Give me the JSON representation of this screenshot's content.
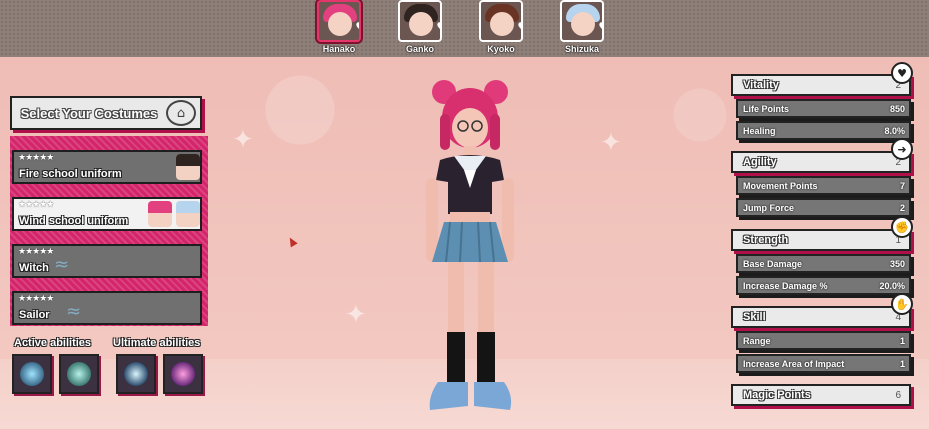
{
  "characters": [
    {
      "name": "Hanako",
      "hair": "#e2407e",
      "active": true
    },
    {
      "name": "Ganko",
      "hair": "#2f2420",
      "active": false
    },
    {
      "name": "Kyoko",
      "hair": "#6a3424",
      "active": false
    },
    {
      "name": "Shizuka",
      "hair": "#b7d4ef",
      "active": false
    }
  ],
  "costumes": {
    "header": "Select Your Costumes",
    "items": [
      {
        "name": "Fire school uniform",
        "stars": "★★★★★"
      },
      {
        "name": "Wind school uniform",
        "stars": "★★★★★"
      },
      {
        "name": "Witch",
        "stars": "★★★★★"
      },
      {
        "name": "Sailor",
        "stars": "★★★★★"
      }
    ]
  },
  "abilities": {
    "active_label": "Active abilities",
    "ultimate_label": "Ultimate abilities"
  },
  "stats": {
    "vitality": {
      "title": "Vitality",
      "value": "2",
      "rows": [
        {
          "label": "Life Points",
          "value": "850"
        },
        {
          "label": "Healing",
          "value": "8.0%"
        }
      ]
    },
    "agility": {
      "title": "Agility",
      "value": "2",
      "rows": [
        {
          "label": "Movement Points",
          "value": "7"
        },
        {
          "label": "Jump Force",
          "value": "2"
        }
      ]
    },
    "strength": {
      "title": "Strength",
      "value": "1",
      "rows": [
        {
          "label": "Base Damage",
          "value": "350"
        },
        {
          "label": "Increase Damage %",
          "value": "20.0%"
        }
      ]
    },
    "skill": {
      "title": "Skill",
      "value": "4",
      "rows": [
        {
          "label": "Range",
          "value": "1"
        },
        {
          "label": "Increase Area of Impact",
          "value": "1"
        }
      ]
    },
    "magic": {
      "title": "Magic Points",
      "value": "6"
    }
  },
  "colors": {
    "accent": "#b0104a",
    "background": "#f0c4bd",
    "panel": "#eaeaea"
  }
}
